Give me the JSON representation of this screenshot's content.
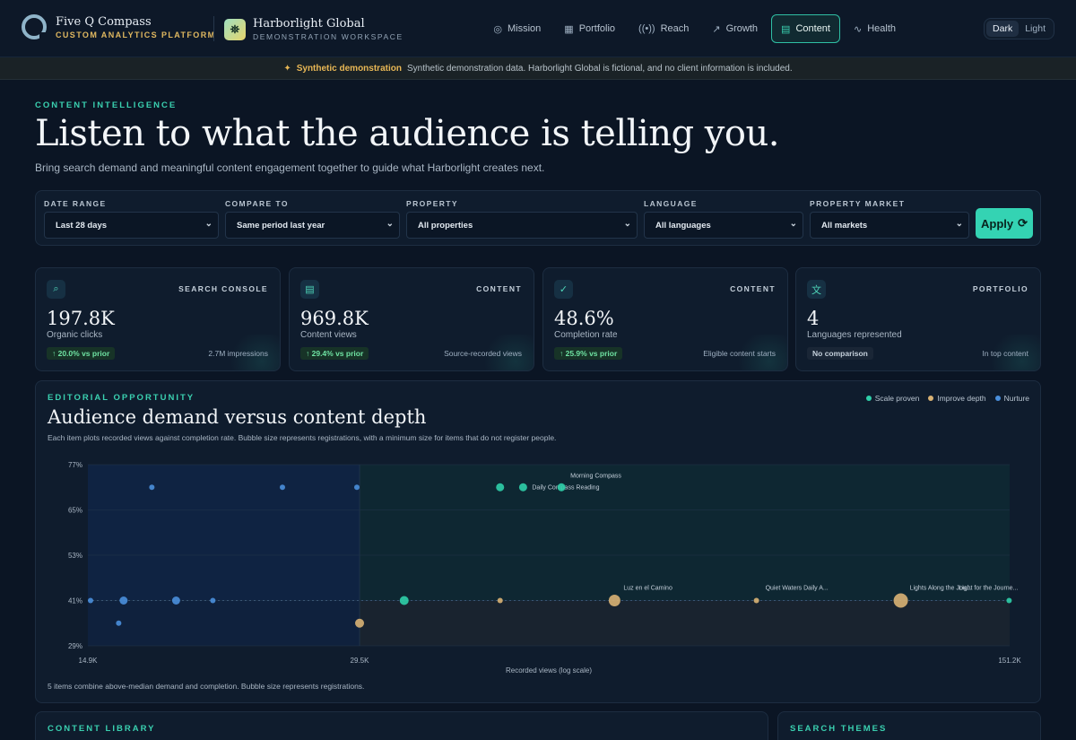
{
  "brand": {
    "name": "Five Q Compass",
    "subtitle": "CUSTOM ANALYTICS PLATFORM"
  },
  "client": {
    "name": "Harborlight Global",
    "subtitle": "DEMONSTRATION WORKSPACE"
  },
  "nav": [
    {
      "label": "Mission",
      "icon": "compass-icon",
      "glyph": "◎",
      "active": false
    },
    {
      "label": "Portfolio",
      "icon": "grid-icon",
      "glyph": "▦",
      "active": false
    },
    {
      "label": "Reach",
      "icon": "broadcast-icon",
      "glyph": "((•))",
      "active": false
    },
    {
      "label": "Growth",
      "icon": "trend-up-icon",
      "glyph": "↗",
      "active": false
    },
    {
      "label": "Content",
      "icon": "document-icon",
      "glyph": "▤",
      "active": true
    },
    {
      "label": "Health",
      "icon": "pulse-icon",
      "glyph": "∿",
      "active": false
    }
  ],
  "theme": {
    "dark": "Dark",
    "light": "Light",
    "selected": "Dark"
  },
  "banner": {
    "strong": "Synthetic demonstration",
    "text": "Synthetic demonstration data. Harborlight Global is fictional, and no client information is included."
  },
  "hero": {
    "eyebrow": "CONTENT INTELLIGENCE",
    "title": "Listen to what the audience is telling you.",
    "subtitle": "Bring search demand and meaningful content engagement together to guide what Harborlight creates next."
  },
  "filters": {
    "date_range": {
      "label": "DATE RANGE",
      "value": "Last 28 days"
    },
    "compare_to": {
      "label": "COMPARE TO",
      "value": "Same period last year"
    },
    "property": {
      "label": "PROPERTY",
      "value": "All properties"
    },
    "language": {
      "label": "LANGUAGE",
      "value": "All languages"
    },
    "market": {
      "label": "PROPERTY MARKET",
      "value": "All markets"
    },
    "apply": "Apply"
  },
  "kpis": [
    {
      "tag": "SEARCH CONSOLE",
      "value": "197.8K",
      "label": "Organic clicks",
      "delta": "↑ 20.0% vs prior",
      "note": "2.7M impressions",
      "icon": "search-icon",
      "glyph": "⌕",
      "neutral": false
    },
    {
      "tag": "CONTENT",
      "value": "969.8K",
      "label": "Content views",
      "delta": "↑ 29.4% vs prior",
      "note": "Source-recorded views",
      "icon": "document-icon",
      "glyph": "▤",
      "neutral": false
    },
    {
      "tag": "CONTENT",
      "value": "48.6%",
      "label": "Completion rate",
      "delta": "↑ 25.9% vs prior",
      "note": "Eligible content starts",
      "icon": "check-badge-icon",
      "glyph": "✓",
      "neutral": false
    },
    {
      "tag": "PORTFOLIO",
      "value": "4",
      "label": "Languages represented",
      "delta": "No comparison",
      "note": "In top content",
      "icon": "translate-icon",
      "glyph": "文",
      "neutral": true
    }
  ],
  "opportunity": {
    "eyebrow": "EDITORIAL OPPORTUNITY",
    "title": "Audience demand versus content depth",
    "subtitle": "Each item plots recorded views against completion rate. Bubble size represents registrations, with a minimum size for items that do not register people.",
    "footnote": "5 items combine above-median demand and completion. Bubble size represents registrations."
  },
  "chart_data": {
    "type": "scatter",
    "xlabel": "Recorded views (log scale)",
    "x_scale": "log",
    "xlim": [
      14900,
      151200
    ],
    "x_ticks": [
      {
        "v": 14900,
        "label": "14.9K"
      },
      {
        "v": 29500,
        "label": "29.5K"
      },
      {
        "v": 151200,
        "label": "151.2K"
      }
    ],
    "ylim": [
      29,
      77
    ],
    "y_ticks": [
      {
        "v": 77,
        "label": "77%"
      },
      {
        "v": 65,
        "label": "65%"
      },
      {
        "v": 53,
        "label": "53%"
      },
      {
        "v": 41,
        "label": "41%"
      },
      {
        "v": 29,
        "label": "29%"
      }
    ],
    "median_x": 29500,
    "median_y": 41,
    "legend_position": "top-right",
    "series": [
      {
        "name": "Scale proven",
        "color": "#2fcfa9"
      },
      {
        "name": "Improve depth",
        "color": "#d9b274"
      },
      {
        "name": "Nurture",
        "color": "#4a8fdc"
      }
    ],
    "points": [
      {
        "x": 15000,
        "y": 41,
        "r": 0,
        "s": 2
      },
      {
        "x": 16300,
        "y": 41,
        "r": 1,
        "s": 2
      },
      {
        "x": 16100,
        "y": 35,
        "r": 0,
        "s": 2
      },
      {
        "x": 17500,
        "y": 71,
        "r": 0,
        "s": 2
      },
      {
        "x": 18600,
        "y": 41,
        "r": 1,
        "s": 2
      },
      {
        "x": 20400,
        "y": 41,
        "r": 0,
        "s": 2
      },
      {
        "x": 24300,
        "y": 71,
        "r": 0,
        "s": 2
      },
      {
        "x": 29300,
        "y": 71,
        "r": 0,
        "s": 2
      },
      {
        "x": 29500,
        "y": 35,
        "r": 2,
        "s": 1
      },
      {
        "x": 33000,
        "y": 41,
        "r": 2,
        "s": 0
      },
      {
        "x": 42000,
        "y": 71,
        "r": 1,
        "s": 0
      },
      {
        "x": 44500,
        "y": 71,
        "r": 1,
        "s": 0,
        "label": "Daily Compass Reading"
      },
      {
        "x": 49000,
        "y": 71,
        "r": 1,
        "s": 0,
        "label": "Morning Compass"
      },
      {
        "x": 42000,
        "y": 41,
        "r": 0,
        "s": 1
      },
      {
        "x": 56000,
        "y": 41,
        "r": 4,
        "s": 1,
        "label": "Luz en el Camino"
      },
      {
        "x": 80000,
        "y": 41,
        "r": 0,
        "s": 1,
        "label": "Quiet Waters Daily A..."
      },
      {
        "x": 115000,
        "y": 41,
        "r": 6,
        "s": 1,
        "label": "Lights Along the Jou..."
      },
      {
        "x": 151000,
        "y": 41,
        "r": 0,
        "s": 0,
        "label": "Light for the Journe..."
      }
    ]
  },
  "bottom": {
    "library": "CONTENT LIBRARY",
    "themes": "SEARCH THEMES"
  }
}
